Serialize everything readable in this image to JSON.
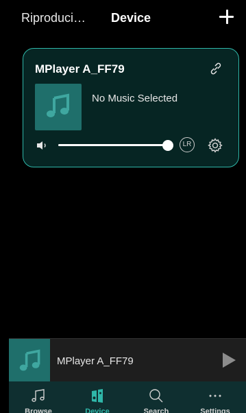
{
  "header": {
    "left_label": "Riproduci…",
    "title": "Device",
    "add_icon": "plus-icon"
  },
  "device_card": {
    "name": "MPlayer A_FF79",
    "link_icon": "link-icon",
    "album_icon": "music-note-icon",
    "now_playing": "No Music Selected",
    "volume_icon": "speaker-icon",
    "volume_level_percent": 100,
    "lr_label": "LR",
    "settings_icon": "gear-icon"
  },
  "mini_player": {
    "title": "MPlayer A_FF79",
    "play_icon": "play-icon"
  },
  "tabs": [
    {
      "label": "Browse",
      "icon": "music-note-icon",
      "active": false
    },
    {
      "label": "Device",
      "icon": "device-icon",
      "active": true
    },
    {
      "label": "Search",
      "icon": "search-icon",
      "active": false
    },
    {
      "label": "Settings",
      "icon": "more-dots-icon",
      "active": false
    }
  ],
  "colors": {
    "accent": "#2fb7a9",
    "card_bg": "#062523",
    "art_bg": "#1f6f6b",
    "tabbar_bg": "#0f2f30"
  }
}
